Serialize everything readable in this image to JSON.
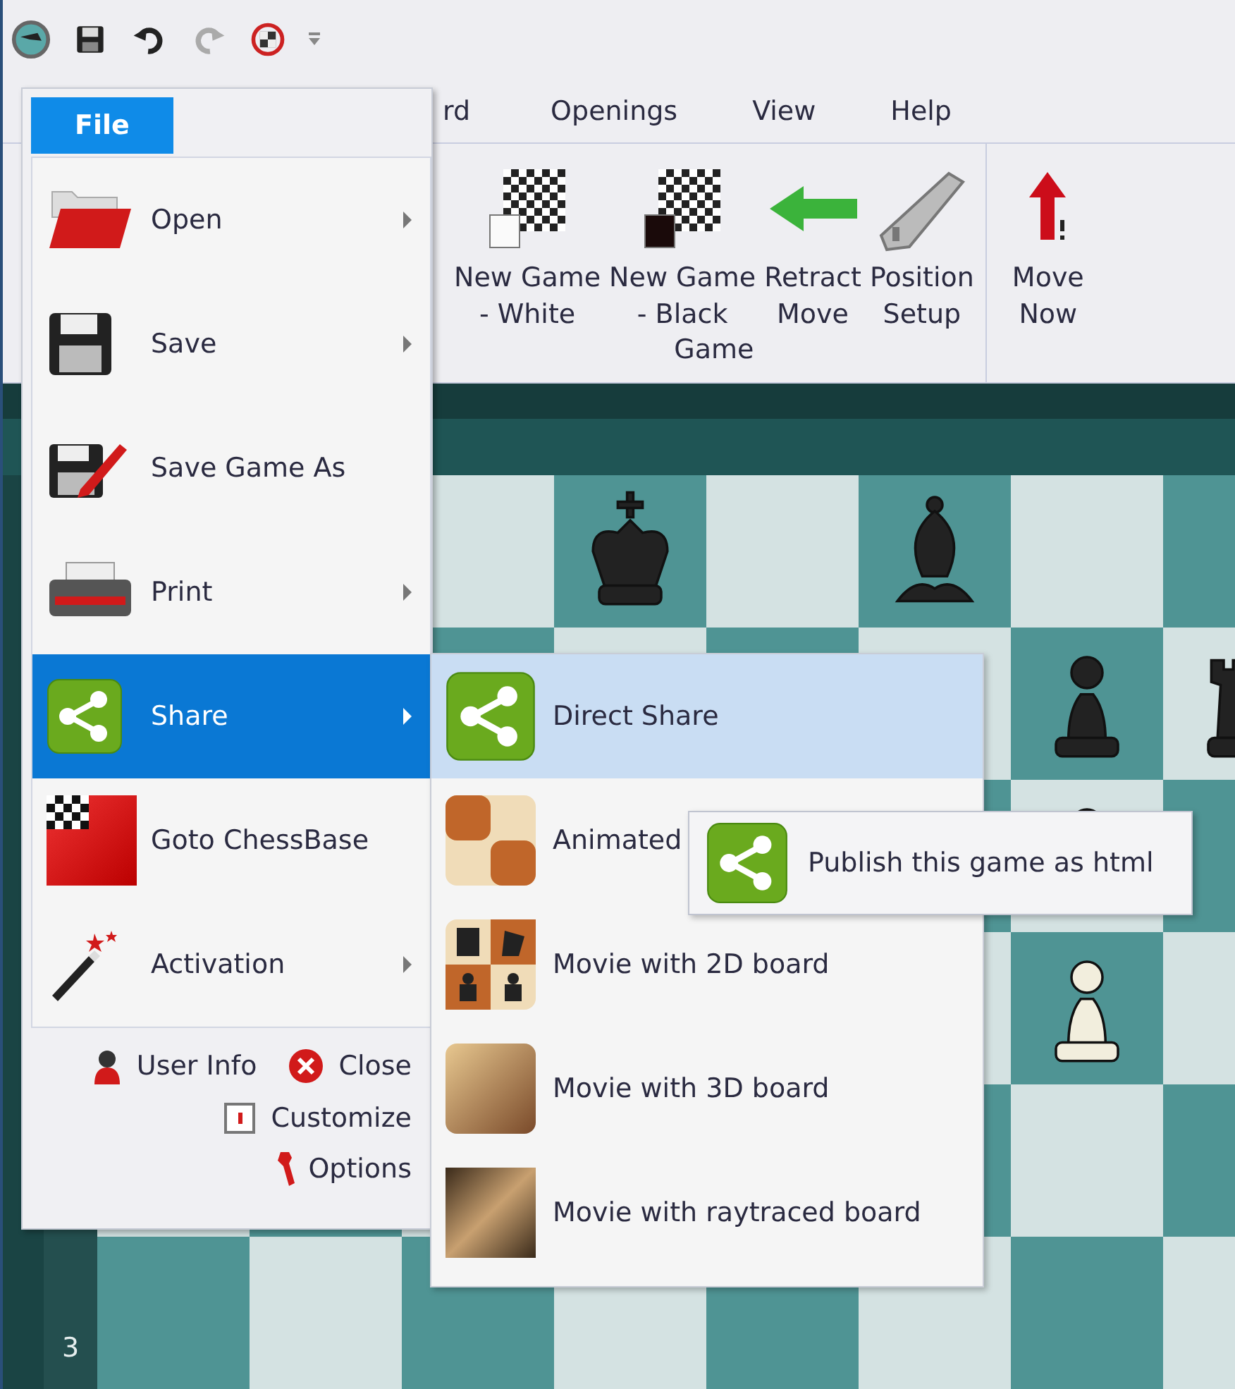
{
  "ribbon_tabs": [
    {
      "label": "rd"
    },
    {
      "label": "Openings"
    },
    {
      "label": "View"
    },
    {
      "label": "Help"
    }
  ],
  "ribbon": {
    "groups": [
      {
        "label": "Game",
        "buttons": [
          {
            "lines": [
              "New Game",
              "- White"
            ]
          },
          {
            "lines": [
              "New Game",
              "- Black"
            ]
          },
          {
            "lines": [
              "Retract",
              "Move"
            ]
          },
          {
            "lines": [
              "Position",
              "Setup"
            ]
          }
        ]
      },
      {
        "buttons": [
          {
            "lines": [
              "Move",
              "Now"
            ]
          }
        ]
      }
    ]
  },
  "board": {
    "rank_label": "3"
  },
  "file_menu": {
    "tab": "File",
    "items": [
      {
        "label": "Open",
        "submenu": true,
        "selected": false
      },
      {
        "label": "Save",
        "submenu": true,
        "selected": false
      },
      {
        "label": "Save Game As",
        "submenu": false,
        "selected": false
      },
      {
        "label": "Print",
        "submenu": true,
        "selected": false
      },
      {
        "label": "Share",
        "submenu": true,
        "selected": true
      },
      {
        "label": "Goto ChessBase",
        "submenu": false,
        "selected": false
      },
      {
        "label": "Activation",
        "submenu": true,
        "selected": false
      }
    ],
    "footer_rows": [
      [
        "User Info",
        "Close"
      ],
      [
        "Customize"
      ],
      [
        "Options"
      ]
    ]
  },
  "share_submenu": {
    "items": [
      {
        "label": "Direct Share",
        "selected": true
      },
      {
        "label": "Animated",
        "selected": false
      },
      {
        "label": "Movie with 2D board",
        "selected": false
      },
      {
        "label": "Movie with 3D board",
        "selected": false
      },
      {
        "label": "Movie with raytraced board",
        "selected": false
      }
    ]
  },
  "tooltip": {
    "text": "Publish this game as html"
  }
}
